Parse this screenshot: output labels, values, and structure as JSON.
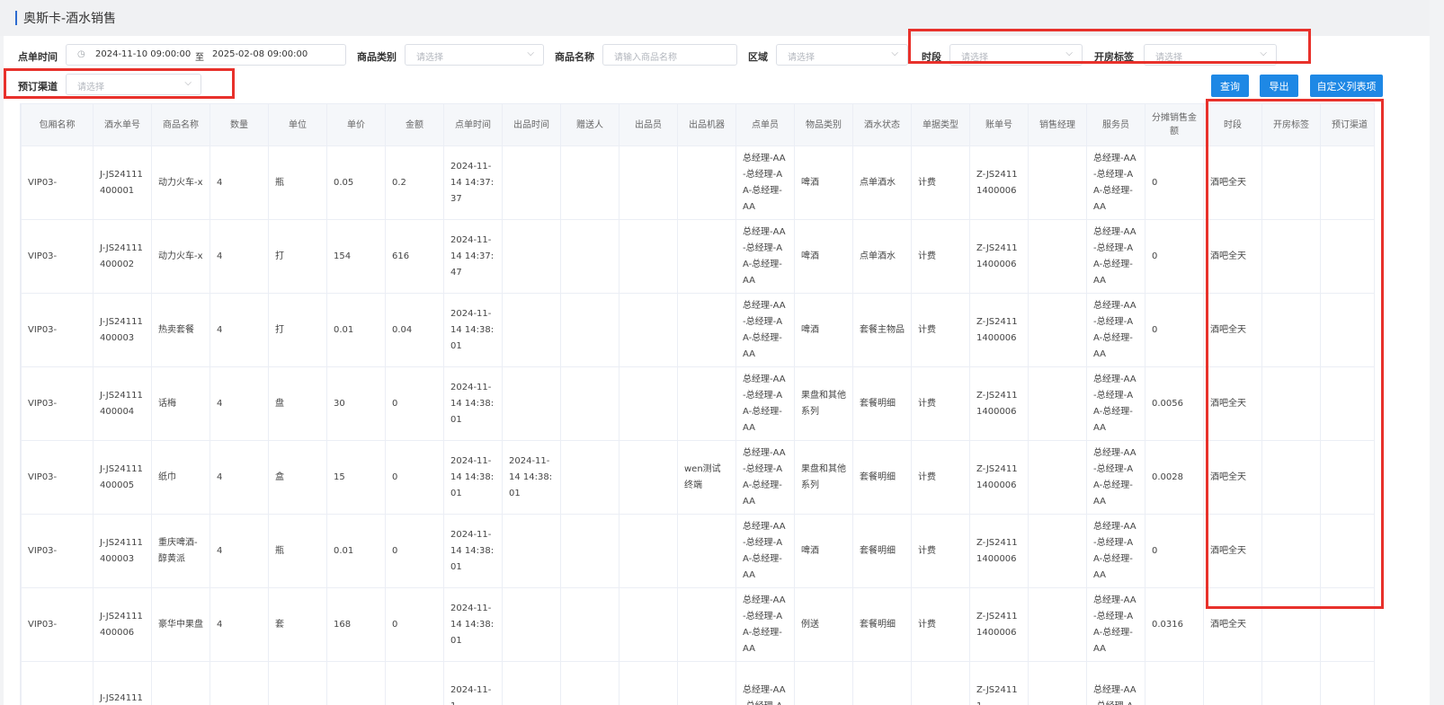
{
  "page": {
    "title": "奥斯卡-酒水销售"
  },
  "filters": {
    "order_time_label": "点单时间",
    "date_start": "2024-11-10 09:00:00",
    "date_sep": "至",
    "date_end": "2025-02-08 09:00:00",
    "category_label": "商品类别",
    "category_placeholder": "请选择",
    "product_label": "商品名称",
    "product_placeholder": "请输入商品名称",
    "area_label": "区域",
    "area_placeholder": "请选择",
    "period_label": "时段",
    "period_placeholder": "请选择",
    "room_tag_label": "开房标签",
    "room_tag_placeholder": "请选择",
    "channel_label": "预订渠道",
    "channel_placeholder": "请选择"
  },
  "actions": {
    "query": "查询",
    "export": "导出",
    "custom_columns": "自定义列表项"
  },
  "table": {
    "headers": [
      "包厢名称",
      "酒水单号",
      "商品名称",
      "数量",
      "单位",
      "单价",
      "金额",
      "点单时间",
      "出品时间",
      "赠送人",
      "出品员",
      "出品机器",
      "点单员",
      "物品类别",
      "酒水状态",
      "单据类型",
      "账单号",
      "销售经理",
      "服务员",
      "分摊销售金额",
      "时段",
      "开房标签",
      "预订渠道"
    ],
    "rows": [
      [
        "VIP03-",
        "J-JS24111400001",
        "动力火车-x",
        "4",
        "瓶",
        "0.05",
        "0.2",
        "2024-11-14 14:37:37",
        "",
        "",
        "",
        "",
        "总经理-AA-总经理-AA-总经理-AA",
        "啤酒",
        "点单酒水",
        "计费",
        "Z-JS24111400006",
        "",
        "总经理-AA-总经理-AA-总经理-AA",
        "0",
        "酒吧全天",
        "",
        ""
      ],
      [
        "VIP03-",
        "J-JS24111400002",
        "动力火车-x",
        "4",
        "打",
        "154",
        "616",
        "2024-11-14 14:37:47",
        "",
        "",
        "",
        "",
        "总经理-AA-总经理-AA-总经理-AA",
        "啤酒",
        "点单酒水",
        "计费",
        "Z-JS24111400006",
        "",
        "总经理-AA-总经理-AA-总经理-AA",
        "0",
        "酒吧全天",
        "",
        ""
      ],
      [
        "VIP03-",
        "J-JS24111400003",
        "热卖套餐",
        "4",
        "打",
        "0.01",
        "0.04",
        "2024-11-14 14:38:01",
        "",
        "",
        "",
        "",
        "总经理-AA-总经理-AA-总经理-AA",
        "啤酒",
        "套餐主物品",
        "计费",
        "Z-JS24111400006",
        "",
        "总经理-AA-总经理-AA-总经理-AA",
        "0",
        "酒吧全天",
        "",
        ""
      ],
      [
        "VIP03-",
        "J-JS24111400004",
        "话梅",
        "4",
        "盘",
        "30",
        "0",
        "2024-11-14 14:38:01",
        "",
        "",
        "",
        "",
        "总经理-AA-总经理-AA-总经理-AA",
        "果盘和其他系列",
        "套餐明细",
        "计费",
        "Z-JS24111400006",
        "",
        "总经理-AA-总经理-AA-总经理-AA",
        "0.0056",
        "酒吧全天",
        "",
        ""
      ],
      [
        "VIP03-",
        "J-JS24111400005",
        "纸巾",
        "4",
        "盒",
        "15",
        "0",
        "2024-11-14 14:38:01",
        "2024-11-14 14:38:01",
        "",
        "",
        "wen测试终端",
        "总经理-AA-总经理-AA-总经理-AA",
        "果盘和其他系列",
        "套餐明细",
        "计费",
        "Z-JS24111400006",
        "",
        "总经理-AA-总经理-AA-总经理-AA",
        "0.0028",
        "酒吧全天",
        "",
        ""
      ],
      [
        "VIP03-",
        "J-JS24111400003",
        "重庆啤酒-醇黄派",
        "4",
        "瓶",
        "0.01",
        "0",
        "2024-11-14 14:38:01",
        "",
        "",
        "",
        "",
        "总经理-AA-总经理-AA-总经理-AA",
        "啤酒",
        "套餐明细",
        "计费",
        "Z-JS24111400006",
        "",
        "总经理-AA-总经理-AA-总经理-AA",
        "0",
        "酒吧全天",
        "",
        ""
      ],
      [
        "VIP03-",
        "J-JS24111400006",
        "豪华中果盘",
        "4",
        "套",
        "168",
        "0",
        "2024-11-14 14:38:01",
        "",
        "",
        "",
        "",
        "总经理-AA-总经理-AA-总经理-AA",
        "例送",
        "套餐明细",
        "计费",
        "Z-JS24111400006",
        "",
        "总经理-AA-总经理-AA-总经理-AA",
        "0.0316",
        "酒吧全天",
        "",
        ""
      ],
      [
        "",
        "J-JS24111",
        "",
        "",
        "",
        "",
        "",
        "2024-11-1",
        "",
        "",
        "",
        "",
        "总经理-AA-总经理-A",
        "",
        "",
        "",
        "Z-JS24111",
        "",
        "总经理-AA-总经理-A",
        "",
        "",
        "",
        ""
      ]
    ]
  },
  "icons": {
    "clock": "clock-icon",
    "chevron": "chevron-down-icon"
  },
  "colors": {
    "accent": "#1e88e5",
    "highlight": "#e8312b",
    "title_bar": "#2d6bd0"
  }
}
